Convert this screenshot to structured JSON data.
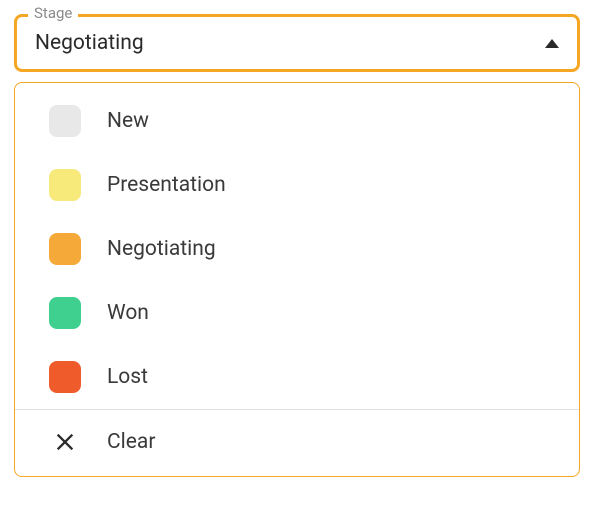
{
  "field": {
    "label": "Stage",
    "selected": "Negotiating"
  },
  "options": [
    {
      "label": "New",
      "color": "#e8e8e8"
    },
    {
      "label": "Presentation",
      "color": "#f7e97a"
    },
    {
      "label": "Negotiating",
      "color": "#f5a939"
    },
    {
      "label": "Won",
      "color": "#3fcf8e"
    },
    {
      "label": "Lost",
      "color": "#f05b2c"
    }
  ],
  "clear": {
    "label": "Clear"
  }
}
